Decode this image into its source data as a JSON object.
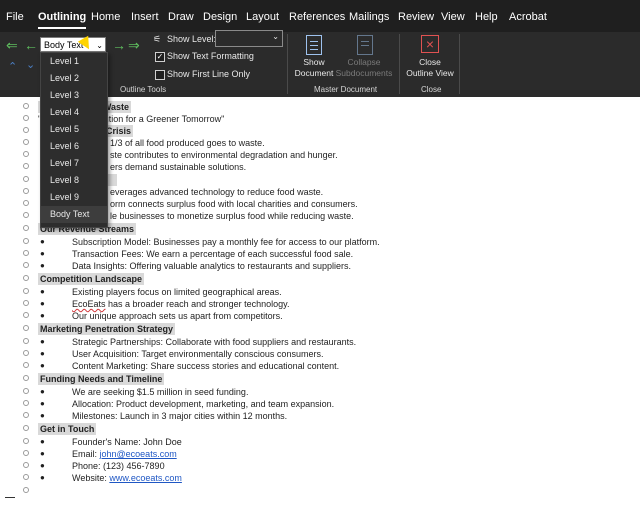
{
  "tabs": [
    "File",
    "Outlining",
    "Home",
    "Insert",
    "Draw",
    "Design",
    "Layout",
    "References",
    "Mailings",
    "Review",
    "View",
    "Help",
    "Acrobat"
  ],
  "ribbon": {
    "level_value": "Body Text",
    "show_level_label": "Show Level:",
    "show_text_formatting": "Show Text Formatting",
    "show_first_line_only": "Show First Line Only",
    "outline_tools_label": "Outline Tools",
    "show_document": "Show Document",
    "show_document_l1": "Show",
    "show_document_l2": "Document",
    "collapse_l1": "Collapse",
    "collapse_l2": "Subdocuments",
    "master_document_label": "Master Document",
    "close_l1": "Close",
    "close_l2": "Outline View",
    "close_group_label": "Close"
  },
  "dropdown": [
    "Level 1",
    "Level 2",
    "Level 3",
    "Level 4",
    "Level 5",
    "Level 6",
    "Level 7",
    "Level 8",
    "Level 9",
    "Body Text"
  ],
  "doc": {
    "title": "Tackling Food Waste",
    "title_visible": "ng Food Waste",
    "subtitle_visible": "nable Solution for a Greener Tomorrow\"",
    "crisis_visible": "Crisis",
    "crisis_1": "1/3 of all food produced goes to waste.",
    "crisis_2": "ste contributes to environmental degradation and hunger.",
    "crisis_3": "ers demand sustainable solutions.",
    "solution_1": "everages advanced technology to reduce food waste.",
    "solution_2": "orm connects surplus food with local charities and consumers.",
    "solution_3": "le businesses to monetize surplus food while reducing waste.",
    "revenue_heading": "Our Revenue Streams",
    "revenue": [
      "Subscription Model: Businesses pay a monthly fee for access to our platform.",
      "Transaction Fees: We earn a percentage of each successful food sale.",
      "Data Insights: Offering valuable analytics to restaurants and suppliers."
    ],
    "competition_heading": "Competition Landscape",
    "competition_1": "Existing players focus on limited geographical areas.",
    "competition_2_word": "EcoEats",
    "competition_2_rest": " has a broader reach and stronger technology.",
    "competition_3": "Our unique approach sets us apart from competitors.",
    "marketing_heading": "Marketing Penetration Strategy",
    "marketing": [
      "Strategic Partnerships: Collaborate with food suppliers and restaurants.",
      "User Acquisition: Target environmentally conscious consumers.",
      "Content Marketing: Share success stories and educational content."
    ],
    "funding_heading": "Funding Needs and Timeline",
    "funding": [
      "We are seeking $1.5 million in seed funding.",
      "Allocation: Product development, marketing, and team expansion.",
      "Milestones: Launch in 3 major cities within 12 months."
    ],
    "contact_heading": "Get in Touch",
    "founder": "Founder's Name: John Doe",
    "email_label": "Email: ",
    "email_value": "john@ecoeats.com",
    "phone": "Phone: (123) 456-7890",
    "website_label": "Website: ",
    "website_value": "www.ecoeats.com"
  },
  "colors": {
    "ribbon_bg": "#2b2b2b",
    "tab_bg": "#1f1f1f",
    "heading_highlight": "#d9d9d9",
    "link": "#1f57c4",
    "cursor": "#ffd400"
  }
}
